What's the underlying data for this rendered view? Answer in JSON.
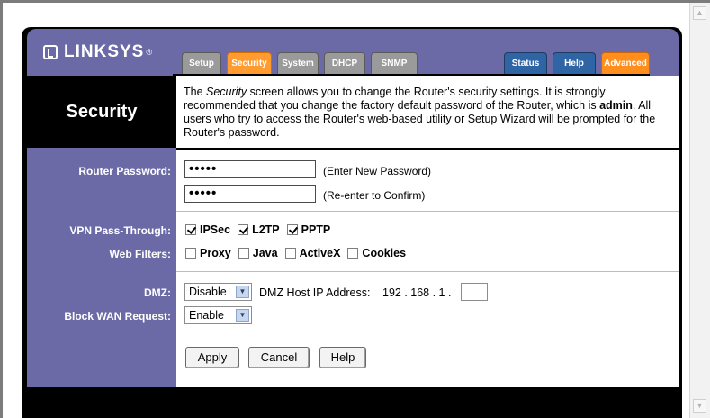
{
  "brand": {
    "name": "LINKSYS",
    "registered": "®"
  },
  "tabs": {
    "setup": "Setup",
    "security": "Security",
    "system": "System",
    "dhcp": "DHCP",
    "snmp": "SNMP",
    "status": "Status",
    "help": "Help",
    "advanced": "Advanced"
  },
  "page": {
    "title": "Security",
    "intro_prefix": "The ",
    "intro_emphasis": "Security",
    "intro_mid": " screen allows you to change the Router's security settings. It is strongly recommended that you change the factory default password of the Router, which is ",
    "intro_bold": "admin",
    "intro_suffix": ". All users who try to access the Router's web-based utility or Setup Wizard will be prompted for the Router's password."
  },
  "router_password": {
    "label": "Router Password:",
    "value1": "•••••",
    "value2": "•••••",
    "hint1": "(Enter New Password)",
    "hint2": "(Re-enter to Confirm)"
  },
  "vpn_pass_through": {
    "label": "VPN Pass-Through:",
    "items": [
      {
        "label": "IPSec",
        "checked": true
      },
      {
        "label": "L2TP",
        "checked": true
      },
      {
        "label": "PPTP",
        "checked": true
      }
    ]
  },
  "web_filters": {
    "label": "Web Filters:",
    "items": [
      {
        "label": "Proxy",
        "checked": false
      },
      {
        "label": "Java",
        "checked": false
      },
      {
        "label": "ActiveX",
        "checked": false
      },
      {
        "label": "Cookies",
        "checked": false
      }
    ]
  },
  "dmz": {
    "label": "DMZ:",
    "selected": "Disable",
    "host_label": "DMZ Host IP Address:",
    "ip_prefix": "192 . 168 . 1 .",
    "ip_last": ""
  },
  "block_wan": {
    "label": "Block WAN Request:",
    "selected": "Enable"
  },
  "buttons": {
    "apply": "Apply",
    "cancel": "Cancel",
    "help": "Help"
  },
  "colors": {
    "purple": "#6b6aa6",
    "tab_active": "#ff9b2f",
    "tab_blue": "#2f65a4",
    "tab_advanced": "#ff8e1d"
  },
  "icons": {
    "select_arrow": "chevron-down-icon",
    "scroll_up": "arrow-up-icon",
    "scroll_down": "arrow-down-icon"
  }
}
